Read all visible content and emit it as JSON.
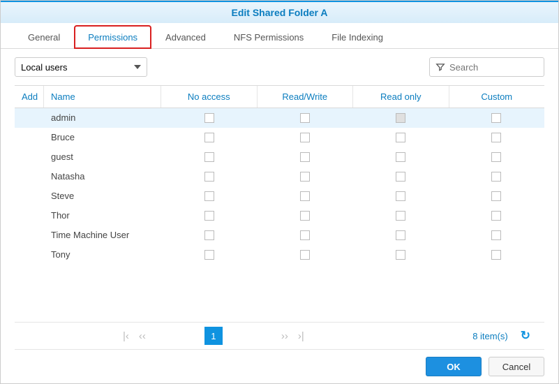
{
  "window_title": "Edit Shared Folder A",
  "tabs": [
    {
      "label": "General",
      "active": false,
      "highlighted": false
    },
    {
      "label": "Permissions",
      "active": true,
      "highlighted": true
    },
    {
      "label": "Advanced",
      "active": false,
      "highlighted": false
    },
    {
      "label": "NFS Permissions",
      "active": false,
      "highlighted": false
    },
    {
      "label": "File Indexing",
      "active": false,
      "highlighted": false
    }
  ],
  "dropdown": {
    "selected": "Local users"
  },
  "search": {
    "placeholder": "Search"
  },
  "columns": {
    "add": "Add",
    "name": "Name",
    "no_access": "No access",
    "read_write": "Read/Write",
    "read_only": "Read only",
    "custom": "Custom"
  },
  "users": [
    {
      "name": "admin",
      "selected": true,
      "no_access": false,
      "read_write": false,
      "read_only": "gray",
      "custom": false
    },
    {
      "name": "Bruce",
      "selected": false,
      "no_access": false,
      "read_write": false,
      "read_only": false,
      "custom": false
    },
    {
      "name": "guest",
      "selected": false,
      "no_access": false,
      "read_write": false,
      "read_only": false,
      "custom": false
    },
    {
      "name": "Natasha",
      "selected": false,
      "no_access": false,
      "read_write": false,
      "read_only": false,
      "custom": false
    },
    {
      "name": "Steve",
      "selected": false,
      "no_access": false,
      "read_write": false,
      "read_only": false,
      "custom": false
    },
    {
      "name": "Thor",
      "selected": false,
      "no_access": false,
      "read_write": false,
      "read_only": false,
      "custom": false
    },
    {
      "name": "Time Machine User",
      "selected": false,
      "no_access": false,
      "read_write": false,
      "read_only": false,
      "custom": false
    },
    {
      "name": "Tony",
      "selected": false,
      "no_access": false,
      "read_write": false,
      "read_only": false,
      "custom": false
    }
  ],
  "pager": {
    "current": "1",
    "items_text": "8 item(s)"
  },
  "buttons": {
    "ok": "OK",
    "cancel": "Cancel"
  }
}
